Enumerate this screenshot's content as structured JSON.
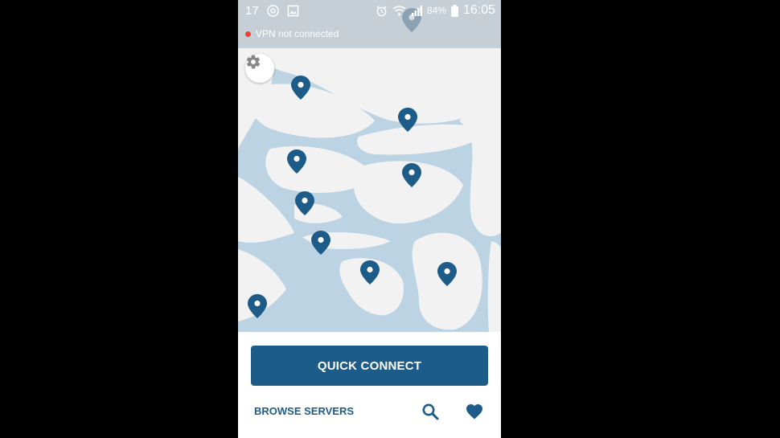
{
  "status_bar": {
    "notification_count": "17",
    "battery_percent": "84%",
    "time": "16:05",
    "vpn_status": "VPN not connected"
  },
  "map": {
    "pin_count": 11
  },
  "actions": {
    "quick_connect_label": "QUICK CONNECT",
    "browse_servers_label": "BROWSE SERVERS"
  },
  "icons": [
    "chrome-icon",
    "image-icon",
    "alarm-icon",
    "wifi-icon",
    "signal-icon",
    "battery-icon",
    "settings-icon",
    "location-pin-icon",
    "search-icon",
    "heart-icon"
  ],
  "colors": {
    "brand_blue": "#1d5c88",
    "water": "#bcd3e3",
    "land": "#f2f2f2",
    "status_dot": "#e8413a"
  }
}
